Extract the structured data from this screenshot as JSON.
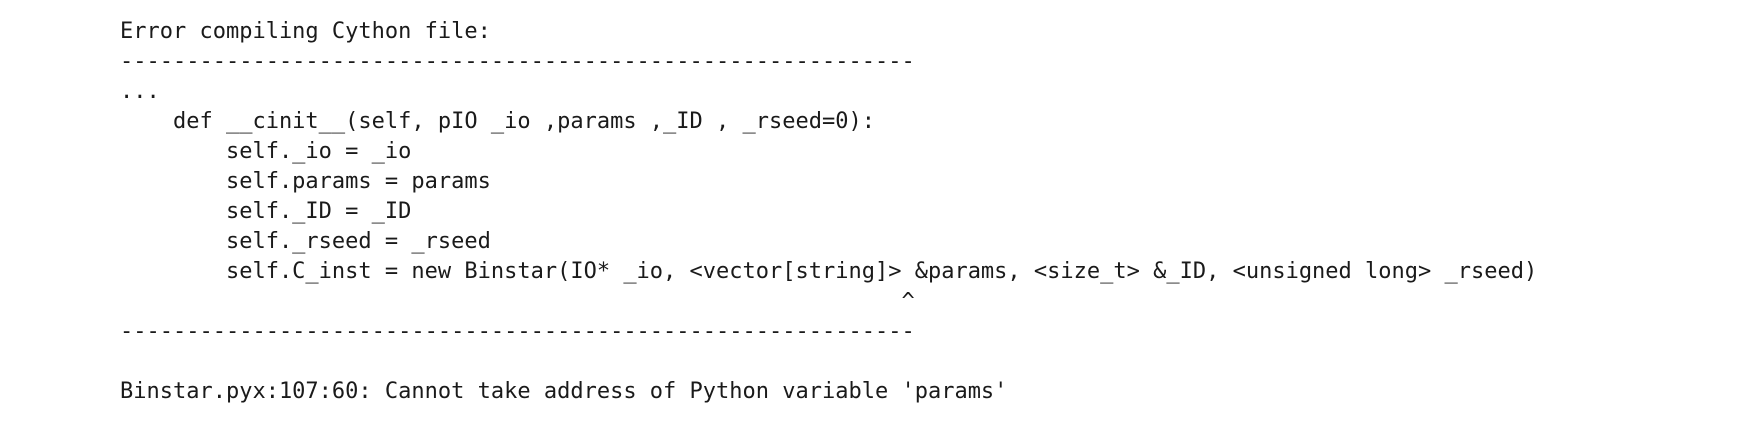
{
  "output": {
    "header": "Error compiling Cython file:",
    "separator_top": "------------------------------------------------------------",
    "ellipsis": "...",
    "code_lines": [
      "    def __cinit__(self, pIO _io ,params ,_ID , _rseed=0):",
      "        self._io = _io",
      "        self.params = params",
      "        self._ID = _ID",
      "        self._rseed = _rseed",
      "        self.C_inst = new Binstar(IO* _io, <vector[string]> &params, <size_t> &_ID, <unsigned long> _rseed)"
    ],
    "caret_line": "                                                           ^",
    "separator_bottom": "------------------------------------------------------------",
    "error_message": "Binstar.pyx:107:60: Cannot take address of Python variable 'params'"
  }
}
